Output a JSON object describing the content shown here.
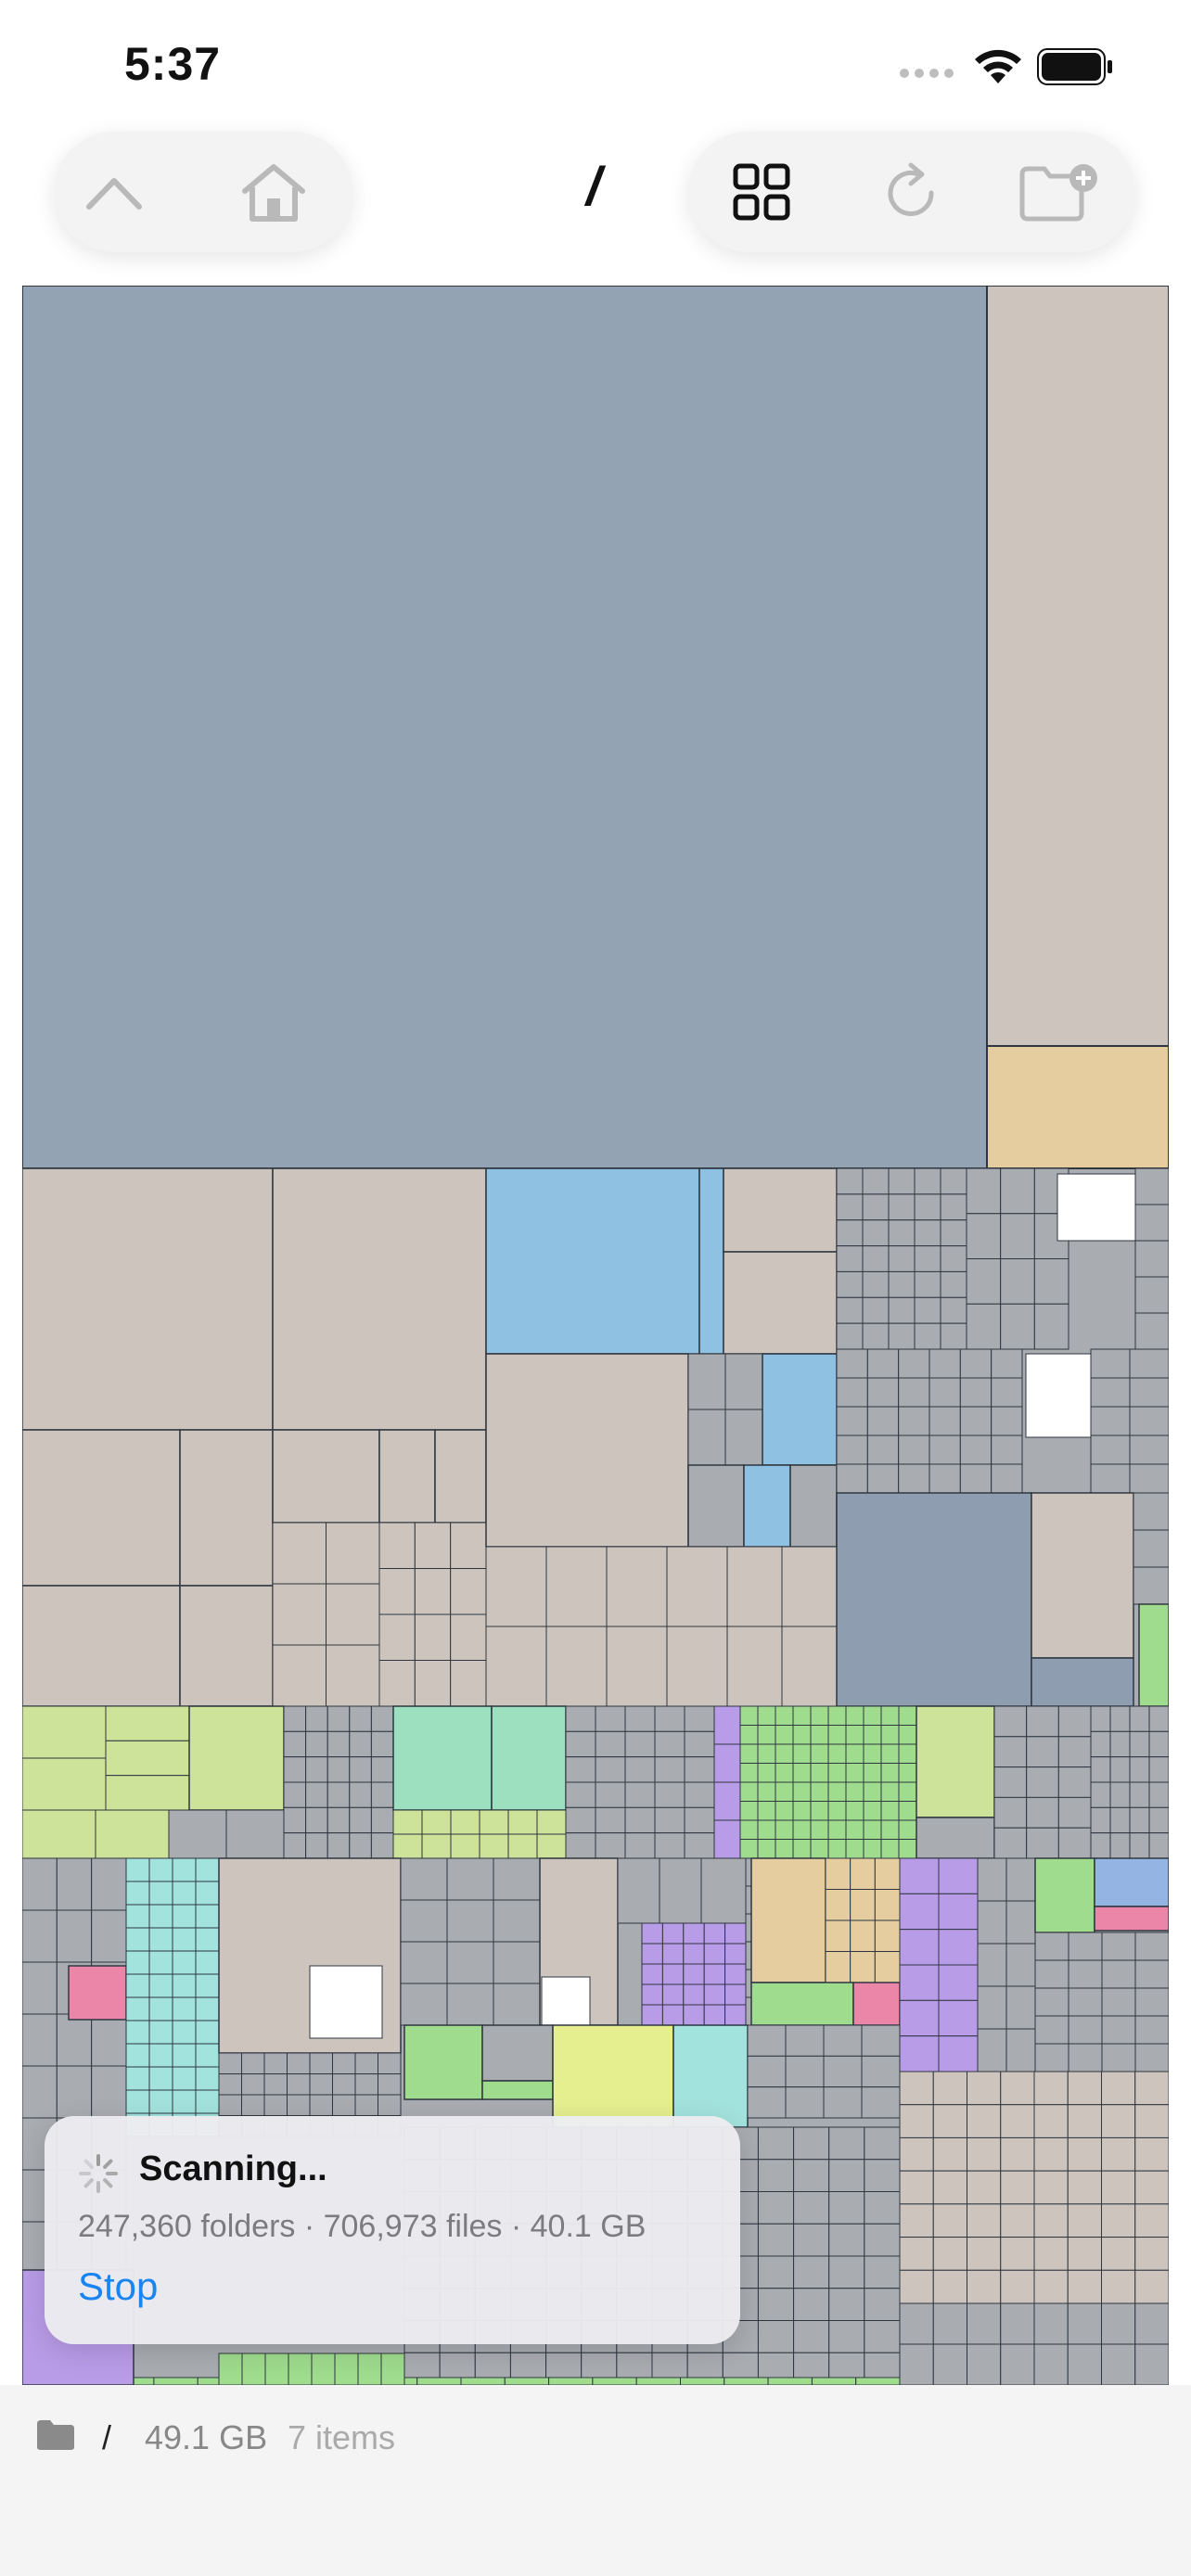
{
  "status": {
    "time": "5:37"
  },
  "toolbar": {
    "up_icon": "chevron-up-icon",
    "home_icon": "home-icon",
    "path": "/",
    "grid_icon": "grid-icon",
    "refresh_icon": "refresh-icon",
    "new_folder_icon": "folder-plus-icon"
  },
  "scan": {
    "title": "Scanning...",
    "stats": "247,360 folders · 706,973 files · 40.1 GB",
    "stop_label": "Stop"
  },
  "footer": {
    "path": "/",
    "size": "49.1 GB",
    "items": "7 items"
  },
  "colors": {
    "treemap_blue": "#94a3b4",
    "treemap_beige": "#cdc5bd",
    "treemap_tan": "#e6cda0",
    "treemap_lightblue": "#8fc1e3",
    "treemap_yellowgreen": "#cde39a",
    "treemap_mint": "#9ce0c0",
    "treemap_green": "#9fdc8e",
    "treemap_purple": "#b99ce8",
    "treemap_pink": "#ec86a8",
    "treemap_teal": "#a3e3dd",
    "treemap_lime": "#e5ef8f",
    "treemap_gray": "#a9acb1",
    "accent": "#1a85f0"
  }
}
